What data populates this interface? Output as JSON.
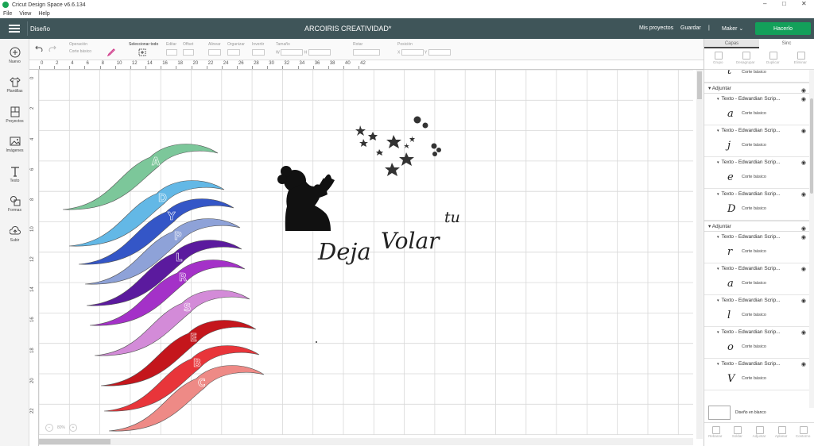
{
  "window": {
    "title": "Cricut Design Space  v6.6.134",
    "controls": [
      "–",
      "□",
      "✕"
    ]
  },
  "menu": [
    "File",
    "View",
    "Help"
  ],
  "header": {
    "section": "Diseño",
    "project_title": "ARCOIRIS CREATIVIDAD*",
    "my_projects": "Mis proyectos",
    "save": "Guardar",
    "separator": "|",
    "machine": "Maker",
    "machine_caret": "⌄",
    "make_button": "Hacerlo",
    "make_color": "#13a05a"
  },
  "left_tools": [
    {
      "label": "Nuevo",
      "icon": "plus-circle-icon"
    },
    {
      "label": "Plantillas",
      "icon": "shirt-icon"
    },
    {
      "label": "Proyectos",
      "icon": "projects-icon"
    },
    {
      "label": "Imágenes",
      "icon": "image-icon"
    },
    {
      "label": "Texto",
      "icon": "text-t-icon"
    },
    {
      "label": "Formas",
      "icon": "shapes-icon"
    },
    {
      "label": "Subir",
      "icon": "upload-cloud-icon"
    }
  ],
  "toolbar": {
    "operation_label": "Operación",
    "operation_value": "Corte básico",
    "select_all": "Seleccionar todo",
    "edit": "Editar",
    "offset": "Offset",
    "align": "Alinear",
    "arrange": "Organizar",
    "flip": "Invertir",
    "size": "Tamaño",
    "size_w": "W",
    "size_h": "H",
    "rotate": "Rotar",
    "position": "Posición",
    "position_x": "X",
    "position_y": "Y"
  },
  "ruler": {
    "h_labels": [
      "0",
      "2",
      "4",
      "6",
      "8",
      "10",
      "12",
      "14",
      "16",
      "18",
      "20",
      "22",
      "24",
      "26",
      "28",
      "30",
      "32",
      "34",
      "36",
      "38",
      "40",
      "42"
    ],
    "v_labels": [
      "0",
      "2",
      "4",
      "6",
      "8",
      "10",
      "12",
      "14",
      "16",
      "18",
      "20",
      "22"
    ]
  },
  "canvas": {
    "texts": {
      "deja": "Deja",
      "volar": "Volar",
      "tu": "tu"
    },
    "arc_letters": [
      "A",
      "D",
      "Y",
      "P",
      "L",
      "R",
      "S",
      "E",
      "B",
      "C"
    ],
    "arc_colors": [
      "#7cc79a",
      "#63b8e6",
      "#3456c7",
      "#8ea2d8",
      "#5b1a9e",
      "#a431c8",
      "#d38bd8",
      "#c4161c",
      "#e8353a",
      "#ee8a86"
    ],
    "zoom_value": "80%",
    "zoom_minus": "−",
    "zoom_plus": "+"
  },
  "panel": {
    "tabs": [
      "Capas",
      "Sinc"
    ],
    "actions": [
      "Grupo",
      "Desagrupar",
      "Duplicar",
      "Eliminar"
    ],
    "top_item_op": "Corte básico",
    "top_item_glyph": "t",
    "groups": [
      {
        "label": "Adjuntar",
        "layers": [
          {
            "name": "Texto - Edwardian Scrip...",
            "glyph": "a",
            "op": "Corte básico"
          },
          {
            "name": "Texto - Edwardian Scrip...",
            "glyph": "j",
            "op": "Corte básico"
          },
          {
            "name": "Texto - Edwardian Scrip...",
            "glyph": "e",
            "op": "Corte básico"
          },
          {
            "name": "Texto - Edwardian Scrip...",
            "glyph": "D",
            "op": "Corte básico"
          }
        ]
      },
      {
        "label": "Adjuntar",
        "layers": [
          {
            "name": "Texto - Edwardian Scrip...",
            "glyph": "r",
            "op": "Corte básico"
          },
          {
            "name": "Texto - Edwardian Scrip...",
            "glyph": "a",
            "op": "Corte básico"
          },
          {
            "name": "Texto - Edwardian Scrip...",
            "glyph": "l",
            "op": "Corte básico"
          },
          {
            "name": "Texto - Edwardian Scrip...",
            "glyph": "o",
            "op": "Corte básico"
          },
          {
            "name": "Texto - Edwardian Scrip...",
            "glyph": "V",
            "op": "Corte básico"
          }
        ]
      }
    ],
    "blank_label": "Diseño en blanco",
    "bottom_actions": [
      "Rebanar",
      "Soldar",
      "Adjuntar",
      "Aplanar",
      "Contorno"
    ]
  }
}
